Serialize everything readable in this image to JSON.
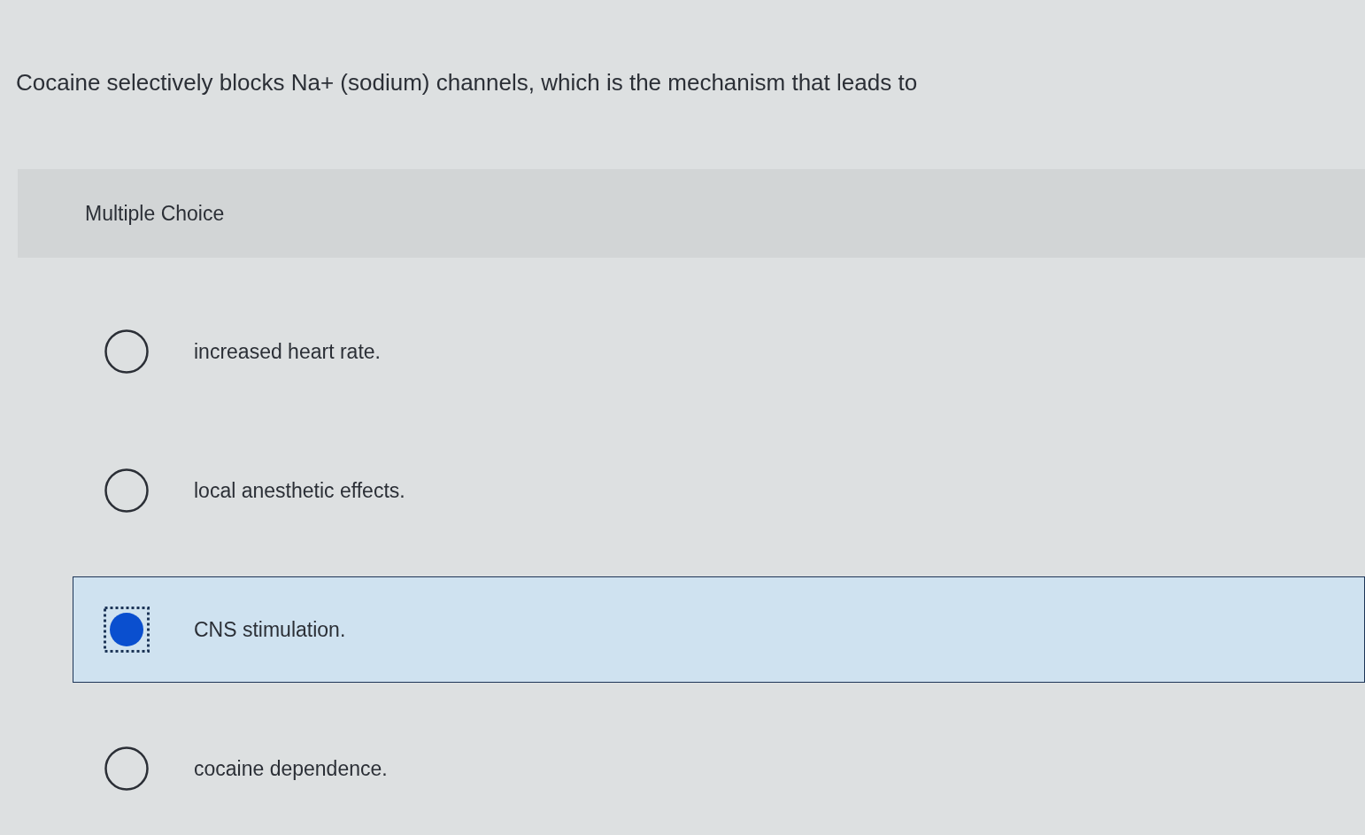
{
  "question": {
    "text": "Cocaine selectively blocks Na+ (sodium) channels, which is the mechanism that leads to"
  },
  "panel": {
    "heading": "Multiple Choice"
  },
  "options": [
    {
      "text": "increased heart rate.",
      "selected": false
    },
    {
      "text": "local anesthetic effects.",
      "selected": false
    },
    {
      "text": "CNS stimulation.",
      "selected": true
    },
    {
      "text": "cocaine dependence.",
      "selected": false
    }
  ]
}
